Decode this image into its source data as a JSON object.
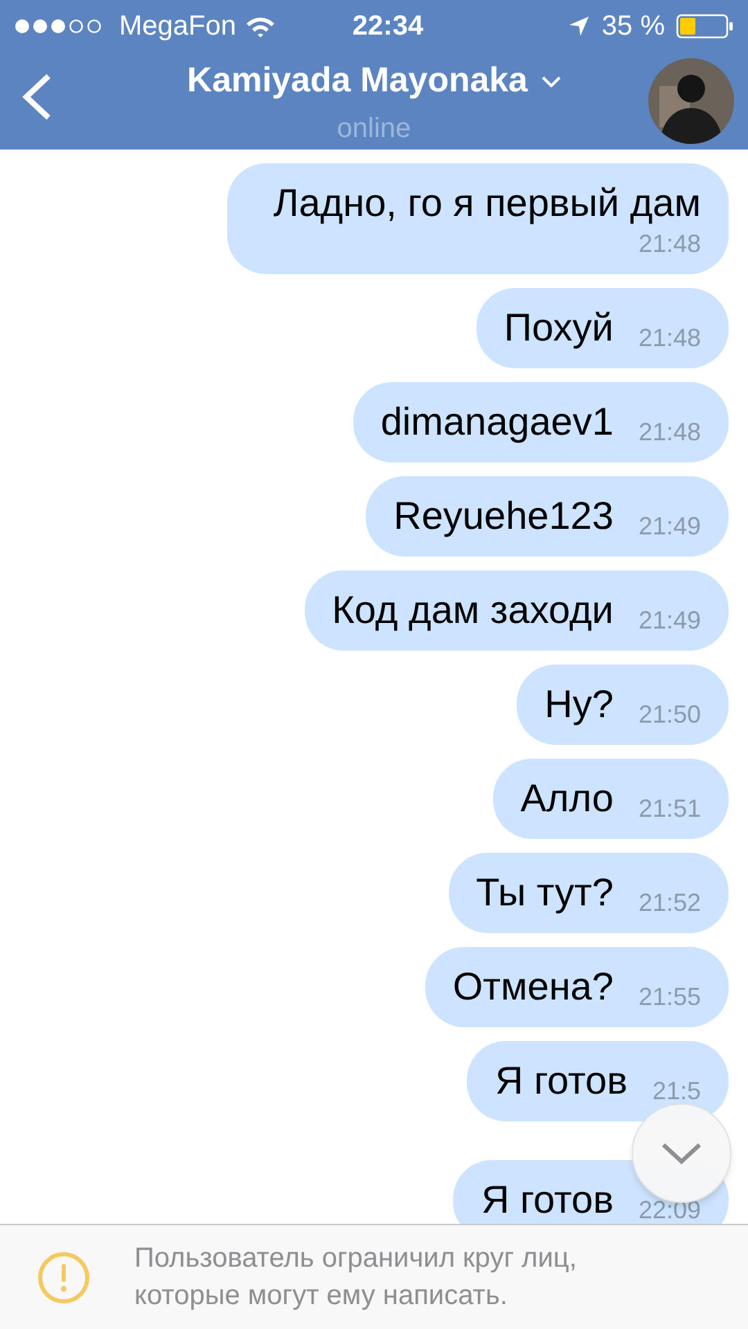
{
  "status_bar": {
    "carrier": "MegaFon",
    "time": "22:34",
    "battery": "35 %"
  },
  "header": {
    "title": "Kamiyada Mayonaka",
    "status": "online"
  },
  "messages": [
    {
      "text": "Ладно, го я первый дам",
      "time": "21:48"
    },
    {
      "text": "Похуй",
      "time": "21:48"
    },
    {
      "text": "dimanagaev1",
      "time": "21:48"
    },
    {
      "text": "Reyuehe123",
      "time": "21:49"
    },
    {
      "text": "Код дам заходи",
      "time": "21:49"
    },
    {
      "text": "Ну?",
      "time": "21:50"
    },
    {
      "text": "Алло",
      "time": "21:51"
    },
    {
      "text": "Ты тут?",
      "time": "21:52"
    },
    {
      "text": "Отмена?",
      "time": "21:55"
    },
    {
      "text": "Я готов",
      "time": "21:5"
    },
    {
      "text": "Я готов",
      "time": "22:09"
    }
  ],
  "notice": "Пользователь ограничил круг лиц, которые могут ему написать."
}
